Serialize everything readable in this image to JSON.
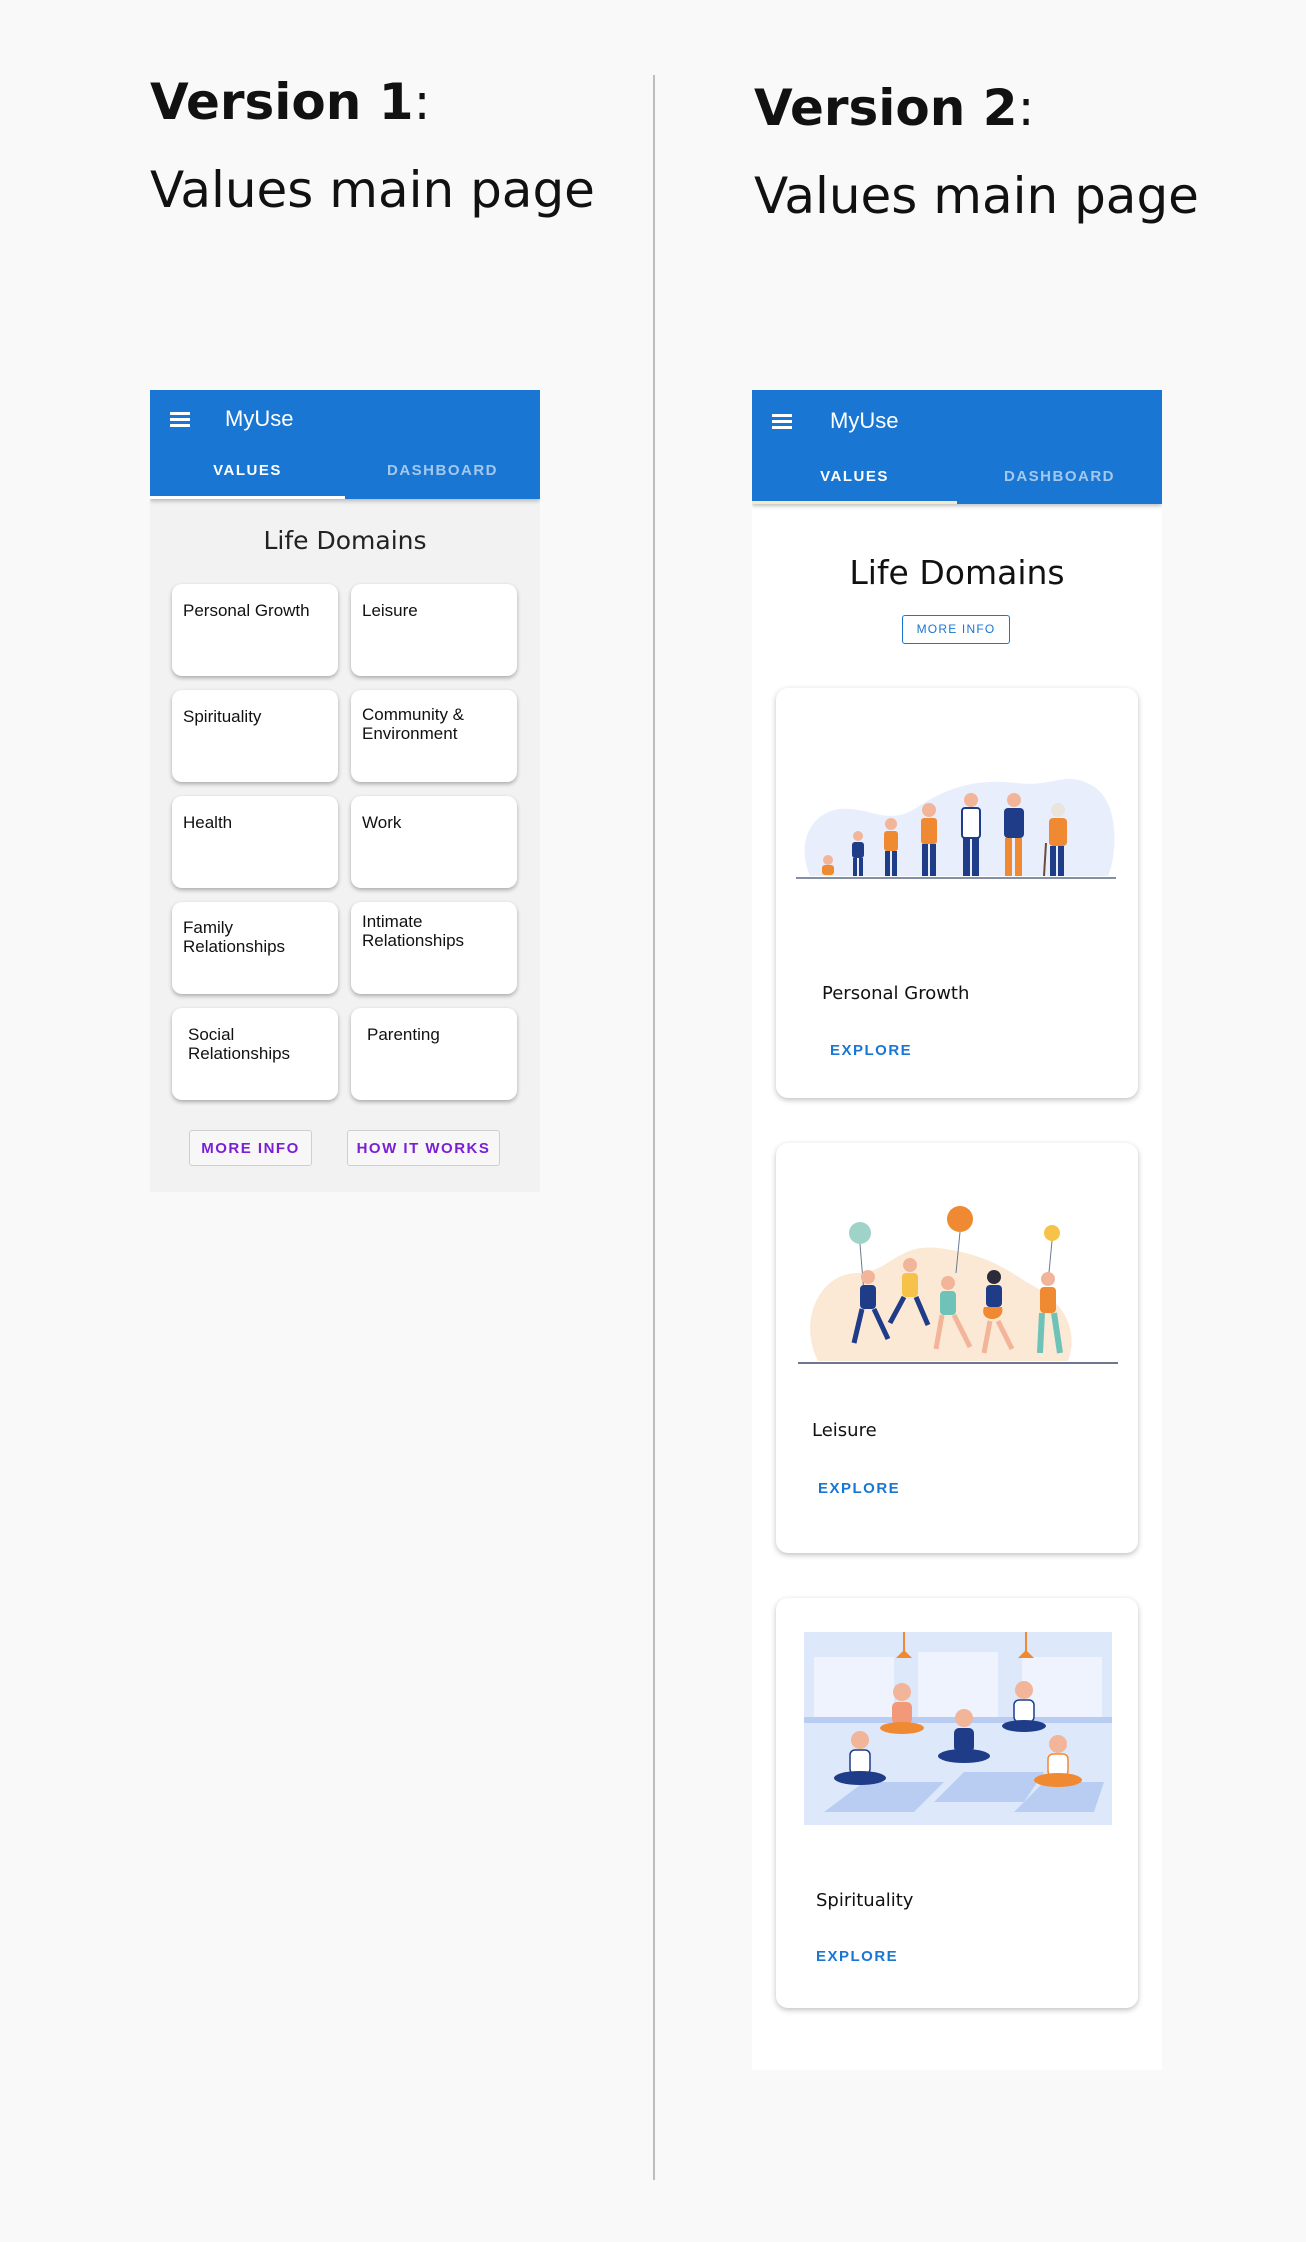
{
  "version1": {
    "heading_bold": "Version 1",
    "heading_colon": ":",
    "subheading": "Values main page",
    "app": {
      "title": "MyUse",
      "tabs": [
        "VALUES",
        "DASHBOARD"
      ],
      "section_title": "Life Domains",
      "tiles": [
        "Personal Growth",
        "Leisure",
        "Spirituality",
        "Community & Environment",
        "Health",
        "Work",
        "Family Relationships",
        "Intimate Relationships",
        "Social Relationships",
        "Parenting"
      ],
      "more_info": "MORE INFO",
      "how_it_works": "HOW IT WORKS"
    }
  },
  "version2": {
    "heading_bold": "Version 2",
    "heading_colon": ":",
    "subheading": "Values main page",
    "app": {
      "title": "MyUse",
      "tabs": [
        "VALUES",
        "DASHBOARD"
      ],
      "section_title": "Life Domains",
      "more_info": "MORE INFO",
      "cards": [
        {
          "label": "Personal Growth",
          "action": "EXPLORE"
        },
        {
          "label": "Leisure",
          "action": "EXPLORE"
        },
        {
          "label": "Spirituality",
          "action": "EXPLORE"
        }
      ]
    }
  },
  "colors": {
    "primary": "#1976d2",
    "accent_v1": "#7b1fd6",
    "tab_indicator_v1": "#ffffff",
    "tab_indicator_v2": "#f5e9c8"
  }
}
